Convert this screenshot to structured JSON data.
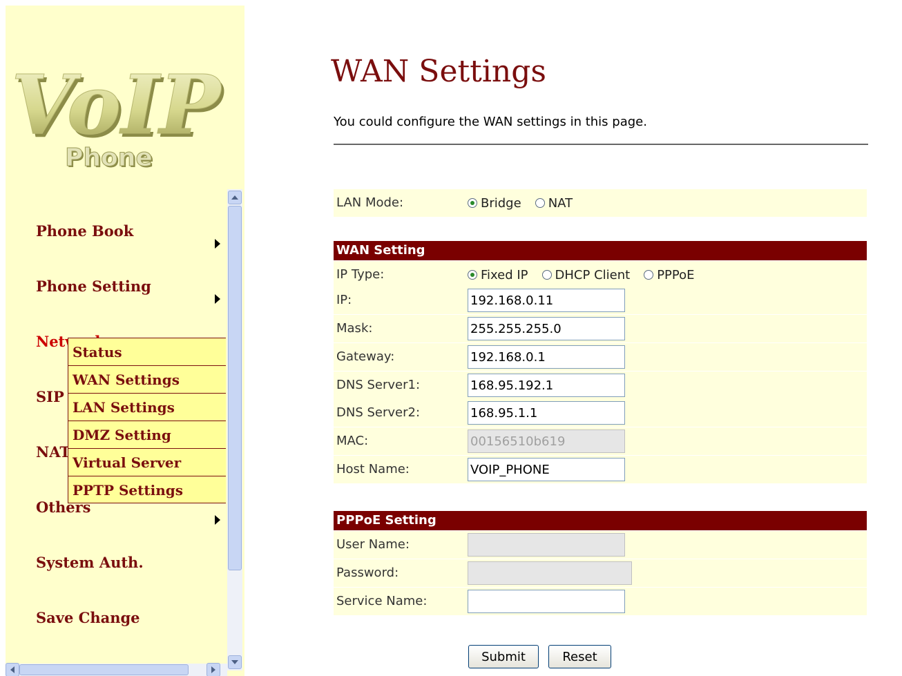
{
  "logo": {
    "main_text": "VoIP",
    "sub_text": "Phone"
  },
  "nav": {
    "phone_book": "Phone Book",
    "phone_setting": "Phone Setting",
    "network": "Network",
    "sip": "SIP",
    "nat": "NAT",
    "others": "Others",
    "system_auth": "System Auth.",
    "save_change": "Save Change",
    "submenu": {
      "status": "Status",
      "wan_settings": "WAN Settings",
      "lan_settings": "LAN Settings",
      "dmz_setting": "DMZ Setting",
      "virtual_server": "Virtual Server",
      "pptp_settings": "PPTP Settings"
    }
  },
  "page": {
    "title": "WAN Settings",
    "description": "You could configure the WAN settings in this page."
  },
  "lan_mode": {
    "label": "LAN Mode:",
    "options": {
      "bridge": "Bridge",
      "nat": "NAT"
    },
    "selected": "Bridge"
  },
  "wan": {
    "header": "WAN Setting",
    "ip_type": {
      "label": "IP Type:",
      "options": {
        "fixed": "Fixed IP",
        "dhcp": "DHCP Client",
        "pppoe": "PPPoE"
      },
      "selected": "Fixed IP"
    },
    "ip": {
      "label": "IP:",
      "value": "192.168.0.11"
    },
    "mask": {
      "label": "Mask:",
      "value": "255.255.255.0"
    },
    "gateway": {
      "label": "Gateway:",
      "value": "192.168.0.1"
    },
    "dns1": {
      "label": "DNS Server1:",
      "value": "168.95.192.1"
    },
    "dns2": {
      "label": "DNS Server2:",
      "value": "168.95.1.1"
    },
    "mac": {
      "label": "MAC:",
      "value": "00156510b619"
    },
    "host": {
      "label": "Host Name:",
      "value": "VOIP_PHONE"
    }
  },
  "pppoe": {
    "header": "PPPoE Setting",
    "user": {
      "label": "User Name:",
      "value": ""
    },
    "password": {
      "label": "Password:",
      "value": ""
    },
    "service": {
      "label": "Service Name:",
      "value": ""
    }
  },
  "buttons": {
    "submit": "Submit",
    "reset": "Reset"
  },
  "colors": {
    "sidebar_bg": "#ffffcc",
    "brand_maroon": "#7a0e0e",
    "section_header": "#7a0000",
    "row_bg": "#ffffdd",
    "active_nav": "#cc0000"
  }
}
